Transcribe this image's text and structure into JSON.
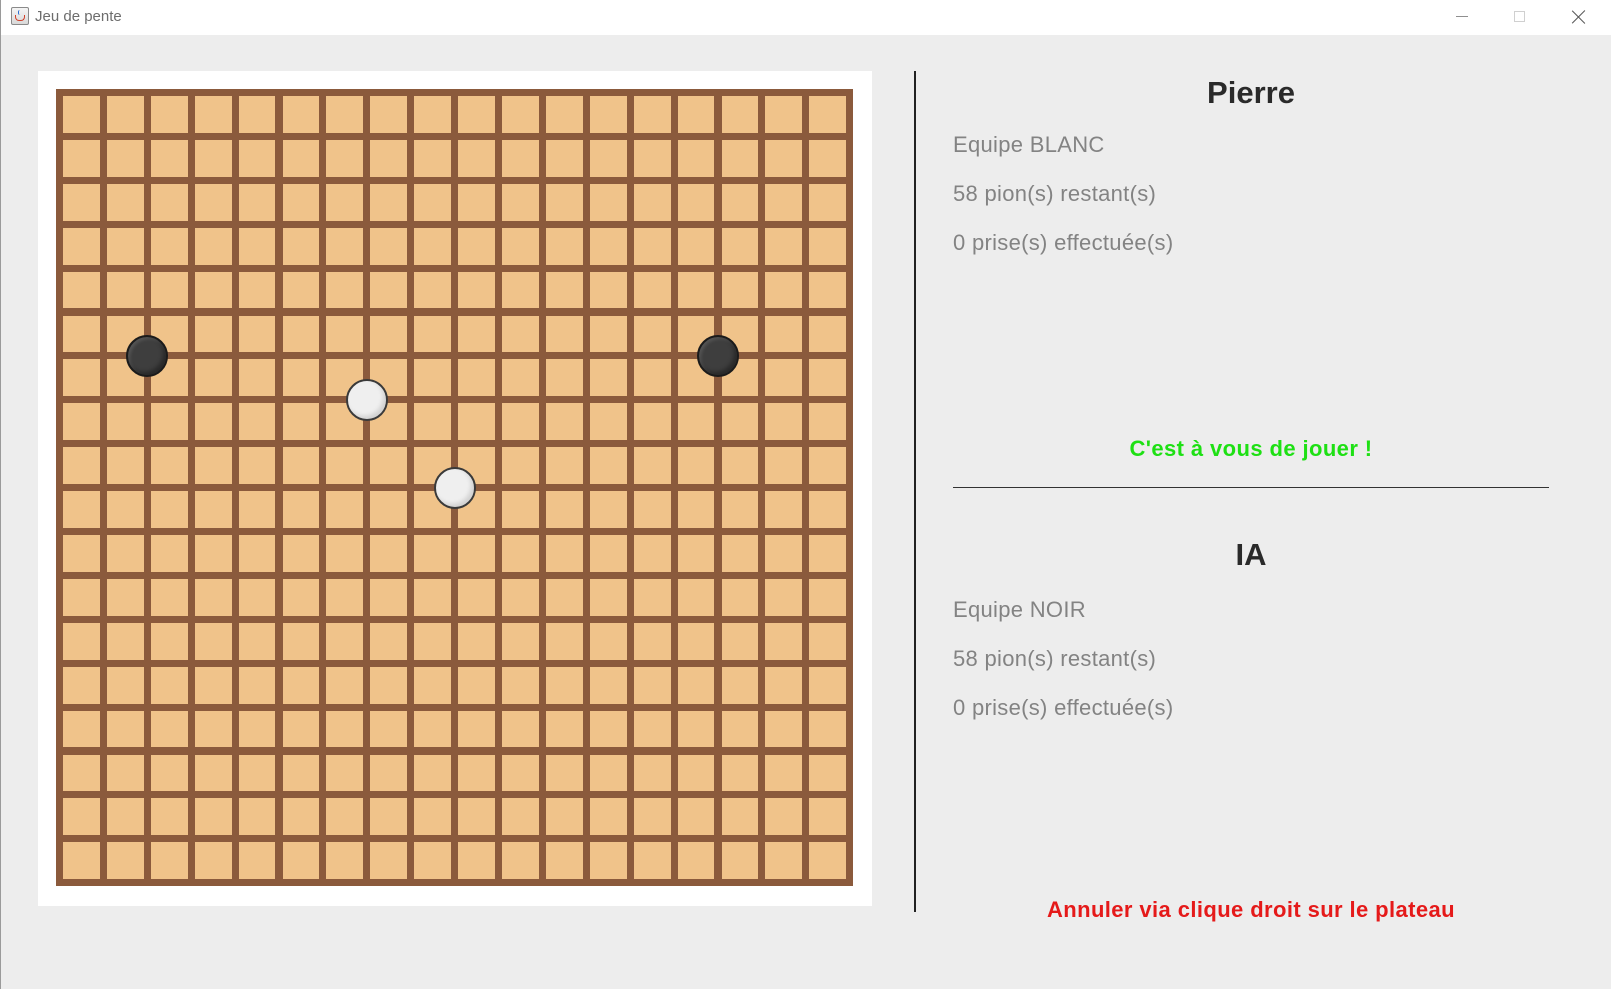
{
  "window": {
    "title": "Jeu de pente",
    "controls": {
      "minimize_icon": "minimize-icon",
      "maximize_icon": "maximize-icon",
      "close_icon": "close-icon"
    }
  },
  "board": {
    "rows": 18,
    "cols": 18,
    "grid_color": "#8b5a3c",
    "cell_color": "#f0c38a",
    "stones": [
      {
        "color": "black",
        "col": 2,
        "row": 6
      },
      {
        "color": "black",
        "col": 15,
        "row": 6
      },
      {
        "color": "white",
        "col": 7,
        "row": 7
      },
      {
        "color": "white",
        "col": 9,
        "row": 9
      }
    ]
  },
  "player1": {
    "name": "Pierre",
    "team": "Equipe BLANC",
    "pieces": "58 pion(s) restant(s)",
    "captures": "0 prise(s) effectuée(s)",
    "turn_message": "C'est à vous de jouer !"
  },
  "player2": {
    "name": "IA",
    "team": "Equipe NOIR",
    "pieces": "58 pion(s) restant(s)",
    "captures": "0 prise(s) effectuée(s)"
  },
  "hint": "Annuler via clique droit sur le plateau",
  "colors": {
    "turn": "#1ee014",
    "hint": "#e51a1a"
  }
}
